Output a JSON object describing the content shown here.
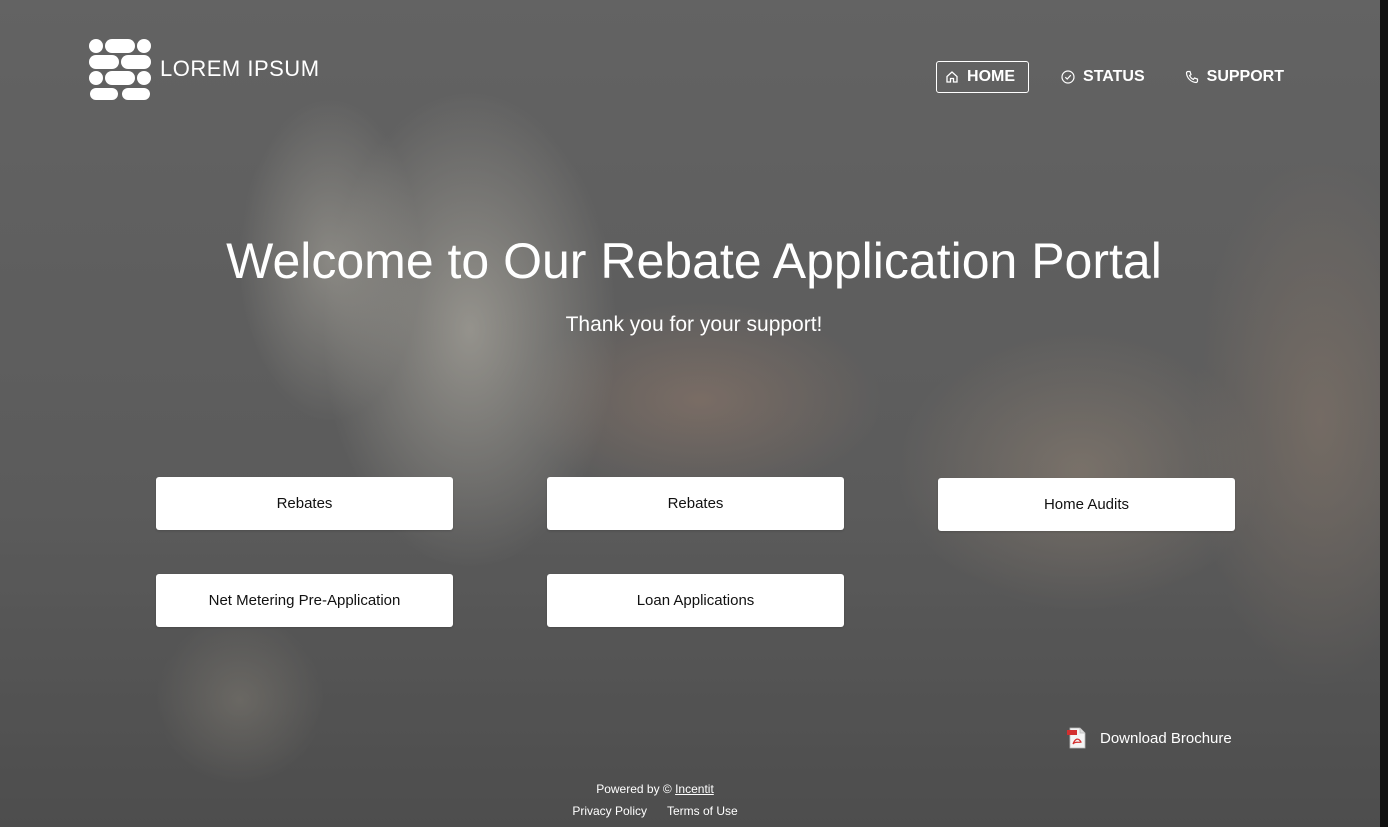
{
  "brand": {
    "name": "LOREM IPSUM",
    "logo_icon": "dots-logo-icon"
  },
  "nav": {
    "items": [
      {
        "label": "HOME",
        "icon": "home-icon",
        "active": true
      },
      {
        "label": "STATUS",
        "icon": "check-circle-icon",
        "active": false
      },
      {
        "label": "SUPPORT",
        "icon": "phone-icon",
        "active": false
      }
    ]
  },
  "hero": {
    "title": "Welcome to Our Rebate Application Portal",
    "subtitle": "Thank you for your support!"
  },
  "tiles": [
    {
      "label": "Rebates"
    },
    {
      "label": "Rebates"
    },
    {
      "label": "Home Audits"
    },
    {
      "label": "Net Metering Pre-Application"
    },
    {
      "label": "Loan Applications"
    }
  ],
  "download": {
    "label": "Download Brochure",
    "icon": "pdf-file-icon"
  },
  "footer": {
    "powered_prefix": "Powered by ©",
    "powered_link": "Incentit",
    "privacy": "Privacy Policy",
    "terms": "Terms of Use"
  },
  "colors": {
    "tile_bg": "#ffffff",
    "text_on_photo": "#ffffff"
  }
}
